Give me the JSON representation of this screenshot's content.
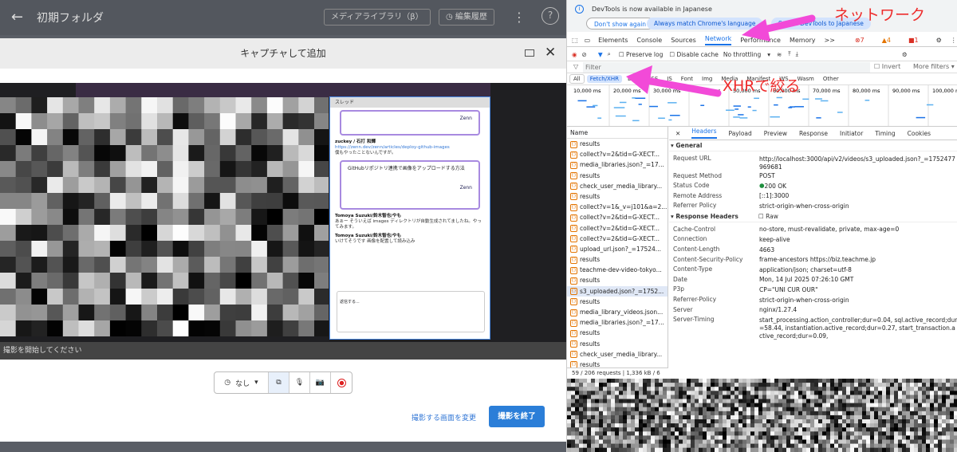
{
  "app": {
    "title": "初期フォルダ",
    "media_library_btn": "メディアライブラリ（β）",
    "edit_history_btn": "編集履歴"
  },
  "modal": {
    "title": "キャプチャして追加",
    "status": "撮影を開始してください",
    "timer_label": "なし",
    "change_screen_link": "撮影する画面を変更",
    "finish_button": "撮影を終了"
  },
  "thread": {
    "header": "スレッド",
    "card1_zenn": "Zenn",
    "msg1_name": "zuckey / 石打 和輝",
    "msg1_url": "https://zenn.dev/zenn/articles/deploy-github-images",
    "msg1_text": "僕もやったことないんですが。",
    "card2_title": "GitHubリポジトリ連携で画像をアップロードする方法",
    "card2_zenn": "Zenn",
    "msg2_name": "Tomoya Suzuki/鈴木智也/やも",
    "msg2_text": "あぁー そういえば images ディレクトリが自動生成されてましたね。やってみます。",
    "msg3_name": "Tomoya Suzuki/鈴木智也/やも",
    "msg3_text": "いけてそうです 画像を配置して読み込み",
    "input_placeholder": "返信する..."
  },
  "devtools": {
    "banner": {
      "text": "DevTools is now available in Japanese",
      "dont_show": "Don't show again",
      "always_match": "Always match Chrome's language",
      "switch": "Switch DevTools to Japanese"
    },
    "tabs": [
      "Elements",
      "Console",
      "Sources",
      "Network",
      "Performance",
      "Memory",
      ">>"
    ],
    "active_tab": "Network",
    "badges": {
      "errors": "7",
      "warnings": "4",
      "info": "1"
    },
    "netbar": {
      "preserve_log": "Preserve log",
      "disable_cache": "Disable cache",
      "throttling": "No throttling"
    },
    "filter": {
      "placeholder": "Filter",
      "invert": "Invert",
      "more_filters": "More filters ▾"
    },
    "type_filters": [
      "All",
      "Fetch/XHR",
      "Doc",
      "CSS",
      "JS",
      "Font",
      "Img",
      "Media",
      "Manifest",
      "WS",
      "Wasm",
      "Other"
    ],
    "timeline_ticks": [
      "10,000 ms",
      "20,000 ms",
      "30,000 ms",
      "40,000 ms",
      "50,000 ms",
      "60,000 ms",
      "70,000 ms",
      "80,000 ms",
      "90,000 ms",
      "100,000 ms",
      "110,0"
    ],
    "list_header": "Name",
    "requests": [
      "results",
      "collect?v=2&tid=G-XECT...",
      "media_libraries.json?_=17...",
      "results",
      "check_user_media_library...",
      "results",
      "collect?v=1&_v=j101&a=2...",
      "collect?v=2&tid=G-XECT...",
      "collect?v=2&tid=G-XECT...",
      "collect?v=2&tid=G-XECT...",
      "upload_url.json?_=17524...",
      "results",
      "teachme-dev-video-tokyo...",
      "results",
      "s3_uploaded.json?_=1752...",
      "results",
      "media_library_videos.json...",
      "media_libraries.json?_=17...",
      "results",
      "results",
      "check_user_media_library...",
      "results"
    ],
    "selected_request": "s3_uploaded.json?_=1752...",
    "status_bar": "59 / 206 requests | 1,336 kB / 6",
    "detail_tabs": [
      "Headers",
      "Payload",
      "Preview",
      "Response",
      "Initiator",
      "Timing",
      "Cookies"
    ],
    "general_label": "General",
    "general": [
      [
        "Request URL",
        "http://localhost:3000/api/v2/videos/s3_uploaded.json?_=1752477969681"
      ],
      [
        "Request Method",
        "POST"
      ],
      [
        "Status Code",
        "200 OK"
      ],
      [
        "Remote Address",
        "[::1]:3000"
      ],
      [
        "Referrer Policy",
        "strict-origin-when-cross-origin"
      ]
    ],
    "response_headers_label": "Response Headers",
    "raw_label": "Raw",
    "response_headers": [
      [
        "Cache-Control",
        "no-store, must-revalidate, private, max-age=0"
      ],
      [
        "Connection",
        "keep-alive"
      ],
      [
        "Content-Length",
        "4663"
      ],
      [
        "Content-Security-Policy",
        "frame-ancestors https://biz.teachme.jp"
      ],
      [
        "Content-Type",
        "application/json; charset=utf-8"
      ],
      [
        "Date",
        "Mon, 14 Jul 2025 07:26:10 GMT"
      ],
      [
        "P3p",
        "CP=\"UNI CUR OUR\""
      ],
      [
        "Referrer-Policy",
        "strict-origin-when-cross-origin"
      ],
      [
        "Server",
        "nginx/1.27.4"
      ],
      [
        "Server-Timing",
        "start_processing.action_controller;dur=0.04, sql.active_record;dur=58.44, instantiation.active_record;dur=0.27, start_transaction.active_record;dur=0.09,"
      ]
    ]
  },
  "annotations": {
    "network_label": "ネットワーク",
    "xhr_label": "XHRで絞る",
    "color": "#ee2c2c",
    "arrow_color": "#f24ad8"
  }
}
